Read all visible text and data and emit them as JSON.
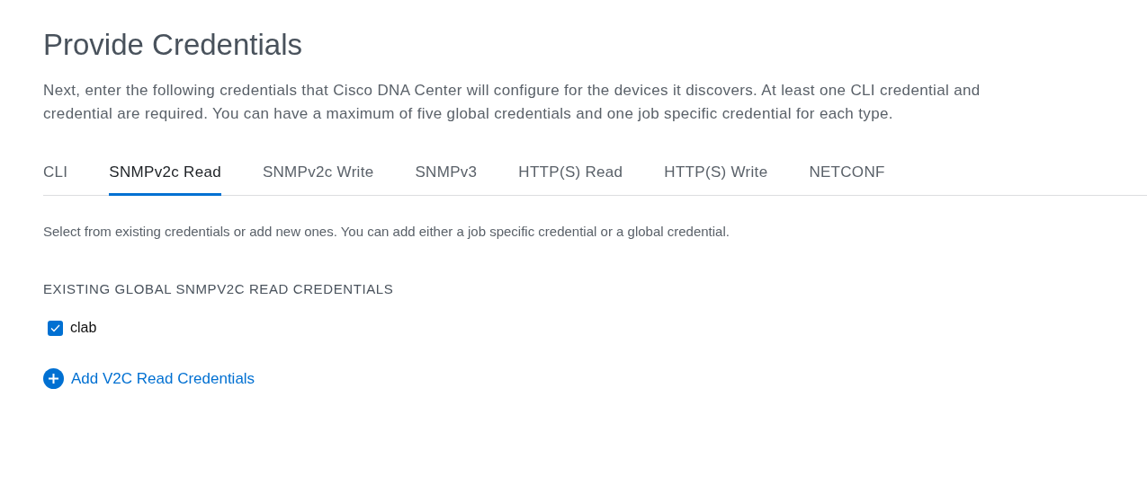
{
  "title": "Provide Credentials",
  "description_lines": [
    "Next, enter the following credentials that Cisco DNA Center will configure for the devices it discovers. At least one CLI credential and",
    "credential are required. You can have a maximum of five global credentials and one job specific credential for each type."
  ],
  "tabs": [
    {
      "label": "CLI",
      "selected": false
    },
    {
      "label": "SNMPv2c Read",
      "selected": true
    },
    {
      "label": "SNMPv2c Write",
      "selected": false
    },
    {
      "label": "SNMPv3",
      "selected": false
    },
    {
      "label": "HTTP(S) Read",
      "selected": false
    },
    {
      "label": "HTTP(S) Write",
      "selected": false
    },
    {
      "label": "NETCONF",
      "selected": false
    }
  ],
  "instruction": "Select from existing credentials or add new ones. You can add either a job specific credential or a global credential.",
  "section_heading": "EXISTING GLOBAL SNMPV2C READ CREDENTIALS",
  "credentials": [
    {
      "label": "clab",
      "checked": true
    }
  ],
  "add_link": "Add V2C Read Credentials"
}
